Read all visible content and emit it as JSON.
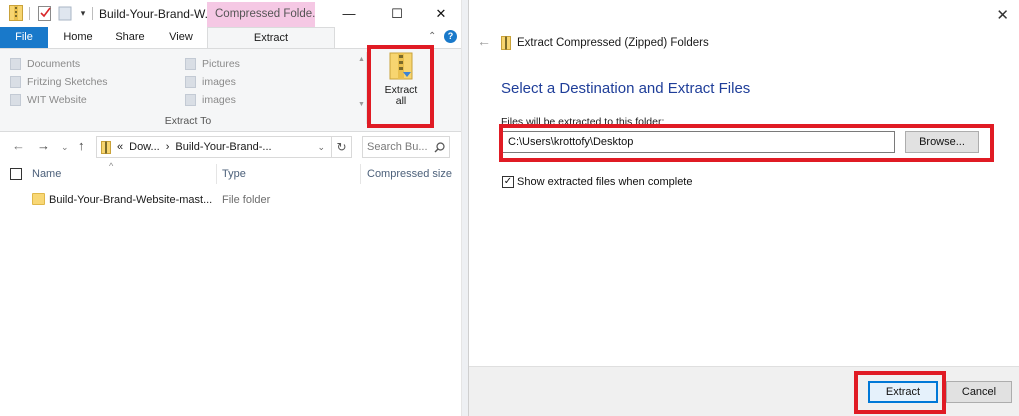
{
  "explorer": {
    "title": "Build-Your-Brand-W...",
    "context_tab": "Compressed Folde...",
    "window_controls": {
      "minimize": "—",
      "maximize": "☐",
      "close": "✕"
    },
    "tabs": [
      {
        "label": "File"
      },
      {
        "label": "Home"
      },
      {
        "label": "Share"
      },
      {
        "label": "View"
      },
      {
        "label": "Extract"
      }
    ],
    "ribbon": {
      "destinations_col1": [
        "Documents",
        "Fritzing Sketches",
        "WIT Website"
      ],
      "destinations_col2": [
        "Pictures",
        "images",
        "images"
      ],
      "extract_all_line1": "Extract",
      "extract_all_line2": "all",
      "group_label": "Extract To"
    },
    "address": {
      "path_prefix": "«",
      "path_part1": "Dow...",
      "path_sep": "›",
      "path_part2": "Build-Your-Brand-...",
      "search_placeholder": "Search Bu..."
    },
    "columns": {
      "name": "Name",
      "type": "Type",
      "compressed_size": "Compressed size"
    },
    "files": [
      {
        "name": "Build-Your-Brand-Website-mast...",
        "type": "File folder"
      }
    ]
  },
  "dialog": {
    "header_title": "Extract Compressed (Zipped) Folders",
    "heading": "Select a Destination and Extract Files",
    "folder_label": "Files will be extracted to this folder:",
    "folder_value": "C:\\Users\\krottofy\\Desktop",
    "browse_label": "Browse...",
    "show_files_label": "Show extracted files when complete",
    "show_files_checked": "✓",
    "extract_label": "Extract",
    "cancel_label": "Cancel"
  },
  "colors": {
    "file_tab": "#1979ca",
    "context_tab": "#f5c8e4",
    "highlight": "#e01b24",
    "heading_blue": "#1f3e99"
  }
}
